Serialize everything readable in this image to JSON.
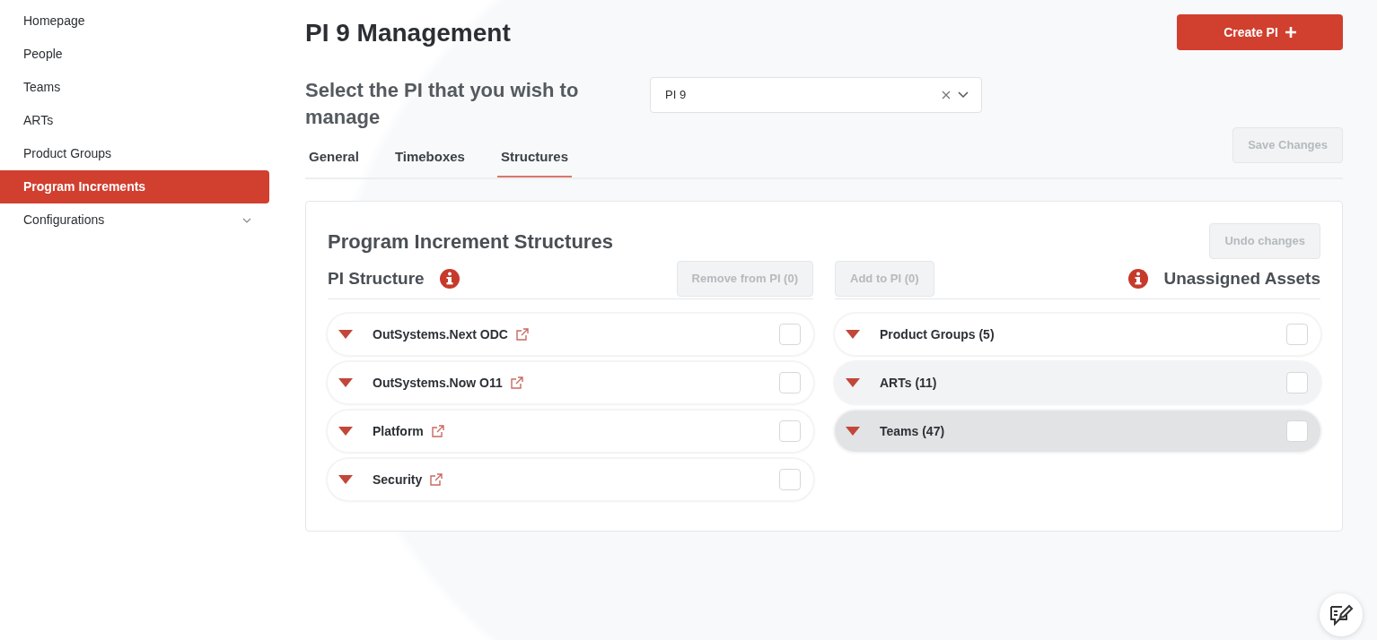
{
  "sidebar": {
    "items": [
      {
        "label": "Homepage",
        "selected": false
      },
      {
        "label": "People",
        "selected": false
      },
      {
        "label": "Teams",
        "selected": false
      },
      {
        "label": "ARTs",
        "selected": false
      },
      {
        "label": "Product Groups",
        "selected": false
      },
      {
        "label": "Program Increments",
        "selected": true
      },
      {
        "label": "Configurations",
        "selected": false,
        "expanded": false
      }
    ]
  },
  "page": {
    "title": "PI 9 Management",
    "create_button": {
      "label": "Create PI",
      "disabled": false
    }
  },
  "pi_selector": {
    "label": "Select the PI that you wish to manage",
    "value": "PI 9"
  },
  "tabs": [
    {
      "label": "General",
      "selected": false
    },
    {
      "label": "Timeboxes",
      "selected": false
    },
    {
      "label": "Structures",
      "selected": true
    }
  ],
  "save_button": {
    "label": "Save Changes",
    "disabled": true
  },
  "structures": {
    "title": "Program Increment Structures",
    "undo_button": {
      "label": "Undo changes",
      "disabled": true
    },
    "pi_structure": {
      "title": "PI Structure",
      "button": {
        "label": "Remove from PI  (0)",
        "disabled": true
      },
      "rows": [
        {
          "label": "OutSystems.Next ODC",
          "expanded": false,
          "checked": false
        },
        {
          "label": "OutSystems.Now O11",
          "expanded": false,
          "checked": false
        },
        {
          "label": "Platform",
          "expanded": false,
          "checked": false
        },
        {
          "label": "Security",
          "expanded": false,
          "checked": false
        }
      ]
    },
    "unassigned": {
      "title": "Unassigned Assets",
      "button": {
        "label": "Add to PI  (0)",
        "disabled": true
      },
      "rows": [
        {
          "label": "Product Groups (5)",
          "expanded": false,
          "checked": false,
          "color": "#ffffff"
        },
        {
          "label": "ARTs (11)",
          "expanded": false,
          "checked": false,
          "color": "#f1f3f4"
        },
        {
          "label": "Teams (47)",
          "expanded": false,
          "checked": false,
          "color": "#e1e3e5"
        }
      ]
    }
  }
}
